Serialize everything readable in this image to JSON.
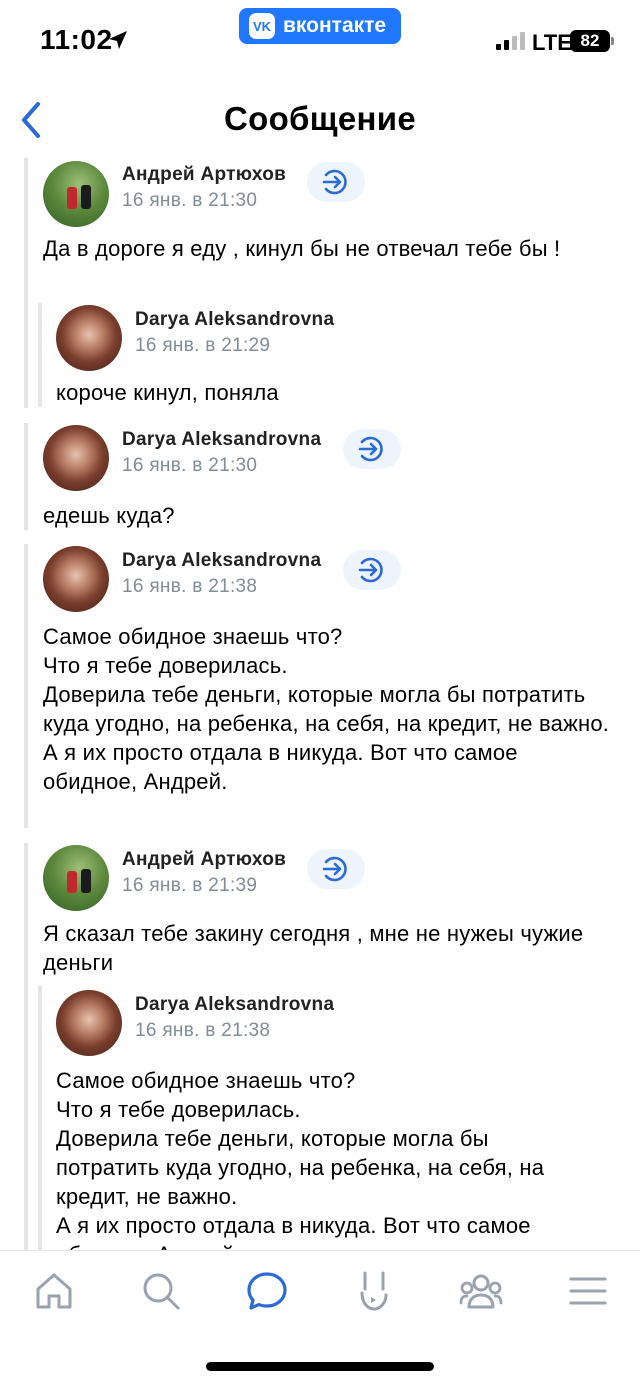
{
  "status_bar": {
    "time": "11:02",
    "network": "LTE",
    "battery": "82"
  },
  "banner": {
    "app_name": "вконтакте",
    "logo_text": "VK"
  },
  "header": {
    "title": "Сообщение"
  },
  "messages": [
    {
      "author": "Андрей Артюхов",
      "date": "16 янв. в 21:30",
      "text": "Да в дороге я еду , кинул бы не отвечал тебе бы !",
      "quote": {
        "author": "Darya Aleksandrovna",
        "date": "16 янв. в 21:29",
        "text": "короче кинул, поняла"
      }
    },
    {
      "author": "Darya Aleksandrovna",
      "date": "16 янв. в 21:30",
      "text": "едешь куда?"
    },
    {
      "author": "Darya Aleksandrovna",
      "date": "16 янв. в 21:38",
      "text": "Самое обидное знаешь что?\nЧто я тебе доверилась.\nДоверила тебе деньги, которые могла бы потратить куда угодно, на ребенка, на себя, на кредит, не важно.\nА я их просто отдала в никуда. Вот что самое обидное, Андрей."
    },
    {
      "author": "Андрей Артюхов",
      "date": "16 янв. в 21:39",
      "text": "Я сказал тебе закину сегодня , мне не нужеы чужие деньги",
      "quote": {
        "author": "Darya Aleksandrovna",
        "date": "16 янв. в 21:38",
        "text": "Самое обидное знаешь что?\nЧто я тебе доверилась.\nДоверила тебе деньги, которые могла бы потратить куда угодно, на ребенка, на себя, на кредит, не важно.\nА я их просто отдала в никуда. Вот что самое обидное, Андрей."
      }
    }
  ],
  "tabbar": {
    "items": [
      "home-icon",
      "search-icon",
      "messages-icon",
      "clips-icon",
      "friends-icon",
      "menu-icon"
    ],
    "active": "messages-icon",
    "accent_color": "#2c6bd6",
    "inactive_color": "#99a2ad"
  }
}
